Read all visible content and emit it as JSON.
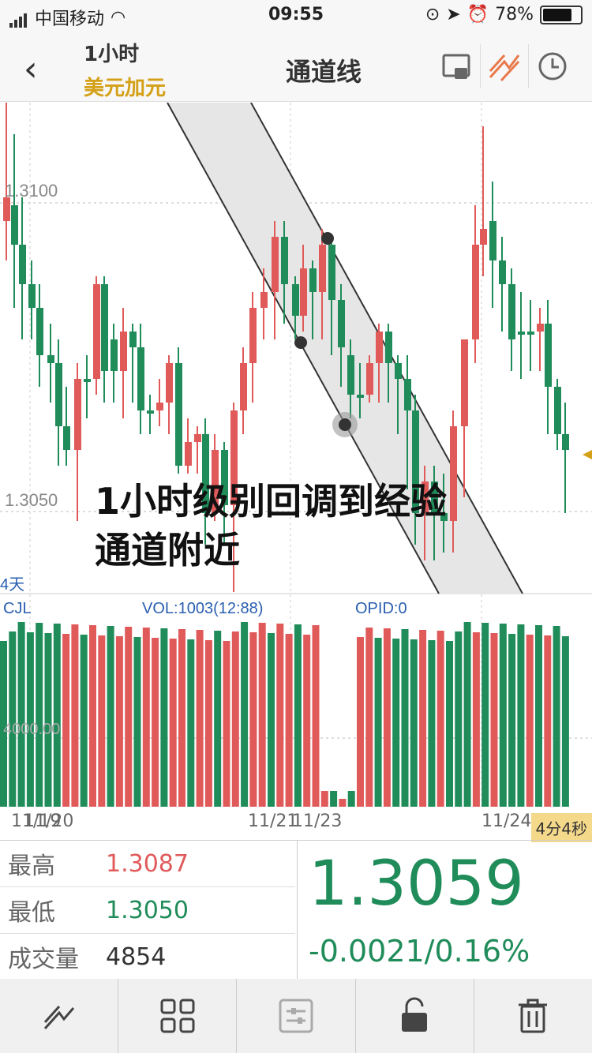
{
  "status_bar": {
    "carrier": "中国移动",
    "time": "09:55",
    "battery": "78%"
  },
  "header": {
    "timeframe": "1小时",
    "pair": "美元加元",
    "title": "通道线"
  },
  "chart": {
    "price_labels": {
      "high": "1.3100",
      "low": "1.3050"
    },
    "period_label": "4天",
    "indicator": {
      "name": "CJL",
      "vol": "VOL:1003(12:88)",
      "opid": "OPID:0"
    },
    "volume_axis_label": "4000.00",
    "x_labels": [
      "11/19",
      "11/20",
      "11/21",
      "11/23",
      "11/24"
    ],
    "countdown": "4分4秒",
    "annotation_line1": "1小时级别回调到经验",
    "annotation_line2": "通道附近",
    "colors": {
      "up": "#e05a5a",
      "down": "#1f8c5a",
      "channel": "#e6e6e6"
    }
  },
  "stats": {
    "high_label": "最高",
    "high_value": "1.3087",
    "low_label": "最低",
    "low_value": "1.3050",
    "volume_label": "成交量",
    "volume_value": "4854",
    "last_price": "1.3059",
    "change": "-0.0021/0.16%"
  },
  "toolbar": [
    "trendline-icon",
    "grid-icon",
    "settings-icon",
    "unlock-icon",
    "trash-icon"
  ]
}
